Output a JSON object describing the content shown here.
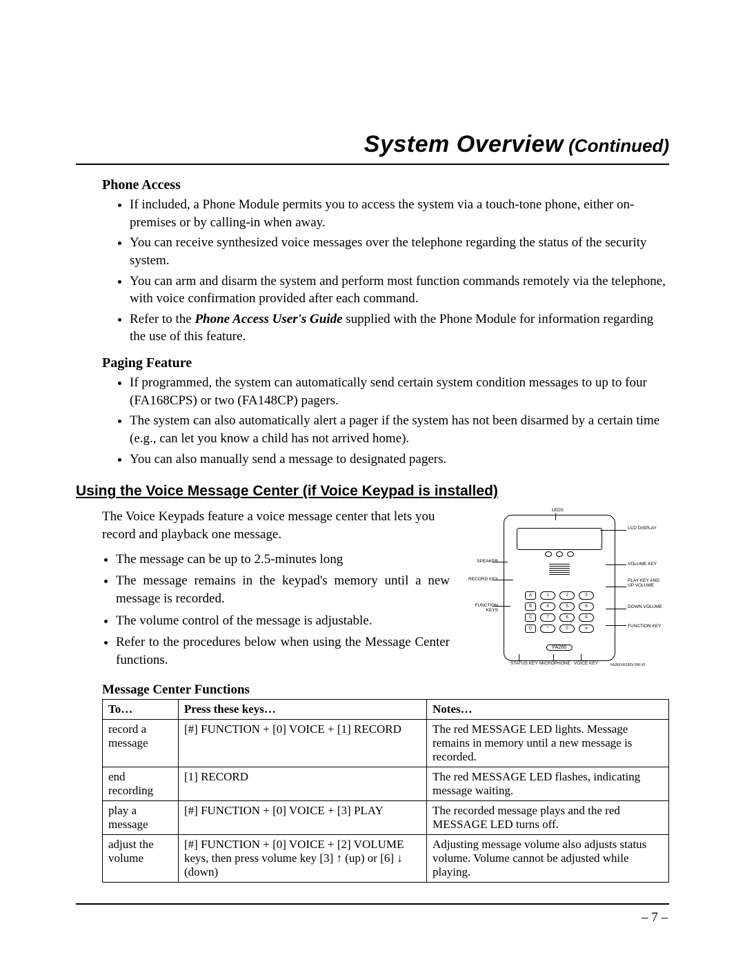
{
  "title": {
    "main": "System Overview",
    "cont": " (Continued)"
  },
  "phone_access": {
    "heading": "Phone Access",
    "b1": "If included, a Phone Module permits you to access the system via a touch-tone phone, either on-premises or by calling-in when away.",
    "b2": "You can receive synthesized voice messages over the telephone regarding the status of the security system.",
    "b3": "You can arm and disarm the system and perform most function commands remotely via the telephone, with voice confirmation provided after each command.",
    "b4a": "Refer to the ",
    "b4b": "Phone Access User's Guide",
    "b4c": " supplied with the Phone Module for information regarding the use of this feature."
  },
  "paging": {
    "heading": "Paging Feature",
    "b1": "If programmed, the system can automatically send certain system condition messages to up to four (FA168CPS) or two (FA148CP) pagers.",
    "b2": "The system can also automatically alert a pager if the system has not been disarmed by a certain time (e.g., can let you know a child has not arrived home).",
    "b3": "You can also manually send a message to designated pagers."
  },
  "vmc": {
    "heading": "Using the Voice Message Center (if Voice Keypad is installed)",
    "intro": "The Voice Keypads feature a voice message center that lets you record and playback one message.",
    "b1": "The message can be up to 2.5-minutes long",
    "b2": "The message remains in the keypad's memory until a new message is recorded.",
    "b3": "The volume control of the message is adjustable.",
    "b4": "Refer to the procedures below when using the Message Center functions."
  },
  "diagram": {
    "leds": "LEDS",
    "lcd": "LCD DISPLAY",
    "speaker": "SPEAKER",
    "record": "RECORD KEY",
    "func": "FUNCTION KEYS",
    "vol": "VOLUME KEY",
    "play": "PLAY KEY AND UP VOLUME",
    "down": "DOWN VOLUME",
    "funckey": "FUNCTION KEY",
    "status": "STATUS KEY",
    "mic": "MICROPHONE",
    "voice": "VOICE KEY",
    "model": "FA260",
    "part": "FA260V/6150V-SM-V0"
  },
  "table": {
    "caption": "Message Center Functions",
    "h_to": "To…",
    "h_keys": "Press these keys…",
    "h_notes": "Notes…",
    "rows": [
      {
        "to": "record a message",
        "keys": "[#] FUNCTION + [0] VOICE + [1] RECORD",
        "notes": "The red MESSAGE LED lights. Message remains in memory until a new message is recorded."
      },
      {
        "to": "end recording",
        "keys": "[1] RECORD",
        "notes": "The red MESSAGE LED flashes, indicating message waiting."
      },
      {
        "to": "play a message",
        "keys": "[#] FUNCTION + [0] VOICE + [3] PLAY",
        "notes": "The recorded message plays and the red MESSAGE LED turns off."
      },
      {
        "to": "adjust the volume",
        "keys": "[#] FUNCTION + [0] VOICE + [2] VOLUME keys, then press volume key [3] ↑ (up) or [6] ↓ (down)",
        "notes": "Adjusting message volume also adjusts status volume. Volume cannot be adjusted while playing."
      }
    ]
  },
  "page_number": "– 7 –"
}
